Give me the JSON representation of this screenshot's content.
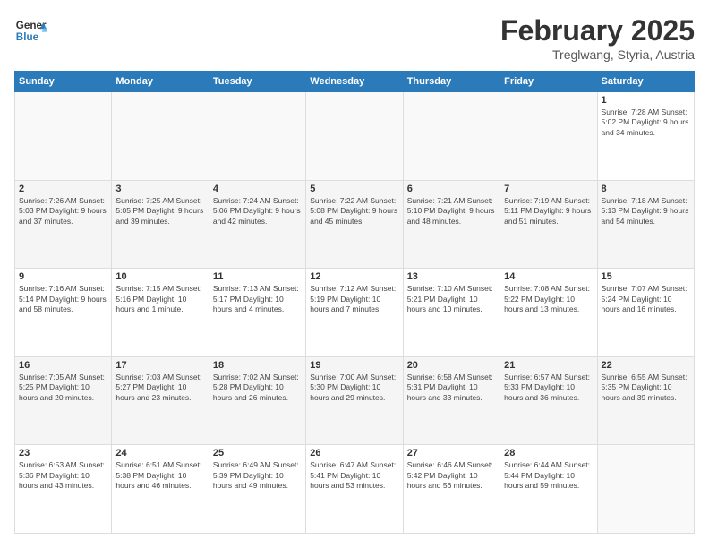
{
  "header": {
    "logo_general": "General",
    "logo_blue": "Blue",
    "month_title": "February 2025",
    "location": "Treglwang, Styria, Austria"
  },
  "days_of_week": [
    "Sunday",
    "Monday",
    "Tuesday",
    "Wednesday",
    "Thursday",
    "Friday",
    "Saturday"
  ],
  "weeks": [
    [
      {
        "day": "",
        "info": ""
      },
      {
        "day": "",
        "info": ""
      },
      {
        "day": "",
        "info": ""
      },
      {
        "day": "",
        "info": ""
      },
      {
        "day": "",
        "info": ""
      },
      {
        "day": "",
        "info": ""
      },
      {
        "day": "1",
        "info": "Sunrise: 7:28 AM\nSunset: 5:02 PM\nDaylight: 9 hours and 34 minutes."
      }
    ],
    [
      {
        "day": "2",
        "info": "Sunrise: 7:26 AM\nSunset: 5:03 PM\nDaylight: 9 hours and 37 minutes."
      },
      {
        "day": "3",
        "info": "Sunrise: 7:25 AM\nSunset: 5:05 PM\nDaylight: 9 hours and 39 minutes."
      },
      {
        "day": "4",
        "info": "Sunrise: 7:24 AM\nSunset: 5:06 PM\nDaylight: 9 hours and 42 minutes."
      },
      {
        "day": "5",
        "info": "Sunrise: 7:22 AM\nSunset: 5:08 PM\nDaylight: 9 hours and 45 minutes."
      },
      {
        "day": "6",
        "info": "Sunrise: 7:21 AM\nSunset: 5:10 PM\nDaylight: 9 hours and 48 minutes."
      },
      {
        "day": "7",
        "info": "Sunrise: 7:19 AM\nSunset: 5:11 PM\nDaylight: 9 hours and 51 minutes."
      },
      {
        "day": "8",
        "info": "Sunrise: 7:18 AM\nSunset: 5:13 PM\nDaylight: 9 hours and 54 minutes."
      }
    ],
    [
      {
        "day": "9",
        "info": "Sunrise: 7:16 AM\nSunset: 5:14 PM\nDaylight: 9 hours and 58 minutes."
      },
      {
        "day": "10",
        "info": "Sunrise: 7:15 AM\nSunset: 5:16 PM\nDaylight: 10 hours and 1 minute."
      },
      {
        "day": "11",
        "info": "Sunrise: 7:13 AM\nSunset: 5:17 PM\nDaylight: 10 hours and 4 minutes."
      },
      {
        "day": "12",
        "info": "Sunrise: 7:12 AM\nSunset: 5:19 PM\nDaylight: 10 hours and 7 minutes."
      },
      {
        "day": "13",
        "info": "Sunrise: 7:10 AM\nSunset: 5:21 PM\nDaylight: 10 hours and 10 minutes."
      },
      {
        "day": "14",
        "info": "Sunrise: 7:08 AM\nSunset: 5:22 PM\nDaylight: 10 hours and 13 minutes."
      },
      {
        "day": "15",
        "info": "Sunrise: 7:07 AM\nSunset: 5:24 PM\nDaylight: 10 hours and 16 minutes."
      }
    ],
    [
      {
        "day": "16",
        "info": "Sunrise: 7:05 AM\nSunset: 5:25 PM\nDaylight: 10 hours and 20 minutes."
      },
      {
        "day": "17",
        "info": "Sunrise: 7:03 AM\nSunset: 5:27 PM\nDaylight: 10 hours and 23 minutes."
      },
      {
        "day": "18",
        "info": "Sunrise: 7:02 AM\nSunset: 5:28 PM\nDaylight: 10 hours and 26 minutes."
      },
      {
        "day": "19",
        "info": "Sunrise: 7:00 AM\nSunset: 5:30 PM\nDaylight: 10 hours and 29 minutes."
      },
      {
        "day": "20",
        "info": "Sunrise: 6:58 AM\nSunset: 5:31 PM\nDaylight: 10 hours and 33 minutes."
      },
      {
        "day": "21",
        "info": "Sunrise: 6:57 AM\nSunset: 5:33 PM\nDaylight: 10 hours and 36 minutes."
      },
      {
        "day": "22",
        "info": "Sunrise: 6:55 AM\nSunset: 5:35 PM\nDaylight: 10 hours and 39 minutes."
      }
    ],
    [
      {
        "day": "23",
        "info": "Sunrise: 6:53 AM\nSunset: 5:36 PM\nDaylight: 10 hours and 43 minutes."
      },
      {
        "day": "24",
        "info": "Sunrise: 6:51 AM\nSunset: 5:38 PM\nDaylight: 10 hours and 46 minutes."
      },
      {
        "day": "25",
        "info": "Sunrise: 6:49 AM\nSunset: 5:39 PM\nDaylight: 10 hours and 49 minutes."
      },
      {
        "day": "26",
        "info": "Sunrise: 6:47 AM\nSunset: 5:41 PM\nDaylight: 10 hours and 53 minutes."
      },
      {
        "day": "27",
        "info": "Sunrise: 6:46 AM\nSunset: 5:42 PM\nDaylight: 10 hours and 56 minutes."
      },
      {
        "day": "28",
        "info": "Sunrise: 6:44 AM\nSunset: 5:44 PM\nDaylight: 10 hours and 59 minutes."
      },
      {
        "day": "",
        "info": ""
      }
    ]
  ]
}
